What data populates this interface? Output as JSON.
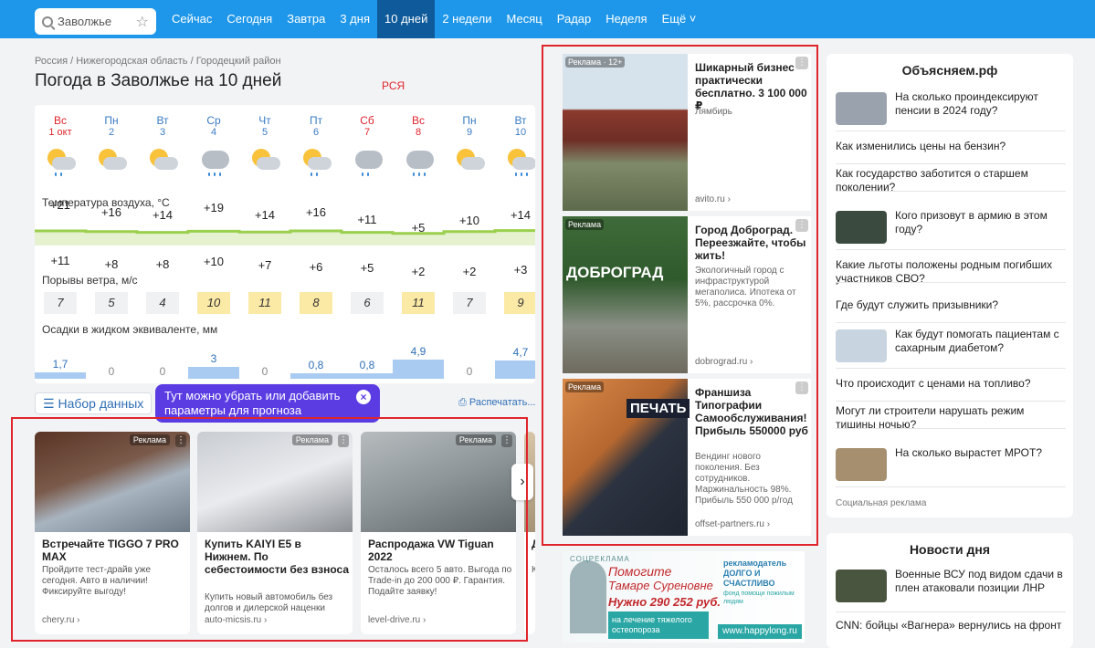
{
  "nav": {
    "search_text": "Заволжье",
    "items": [
      "Сейчас",
      "Сегодня",
      "Завтра",
      "3 дня",
      "10 дней",
      "2 недели",
      "Месяц",
      "Радар",
      "Неделя",
      "Ещё"
    ],
    "active_index": 4
  },
  "breadcrumbs": "Россия / Нижегородская область / Городецкий район",
  "title": "Погода в Заволжье на 10 дней",
  "annotation_rsya": "РСЯ",
  "forecast": {
    "days": [
      {
        "wd": "Вс",
        "date": "1 окт",
        "weekend": true,
        "icon": "partly-cloudy-light-rain-icon",
        "tmax": "+21",
        "tmin": "+11",
        "wind": "7",
        "precip": "1,7",
        "precip_value": 1.7
      },
      {
        "wd": "Пн",
        "date": "2",
        "weekend": false,
        "icon": "partly-cloudy-icon",
        "tmax": "+16",
        "tmin": "+8",
        "wind": "5",
        "precip": "0",
        "precip_value": 0
      },
      {
        "wd": "Вт",
        "date": "3",
        "weekend": false,
        "icon": "partly-cloudy-icon",
        "tmax": "+14",
        "tmin": "+8",
        "wind": "4",
        "precip": "0",
        "precip_value": 0
      },
      {
        "wd": "Ср",
        "date": "4",
        "weekend": false,
        "icon": "cloudy-rain-icon",
        "tmax": "+19",
        "tmin": "+10",
        "wind": "10",
        "precip": "3",
        "precip_value": 3
      },
      {
        "wd": "Чт",
        "date": "5",
        "weekend": false,
        "icon": "partly-cloudy-icon",
        "tmax": "+14",
        "tmin": "+7",
        "wind": "11",
        "precip": "0",
        "precip_value": 0
      },
      {
        "wd": "Пт",
        "date": "6",
        "weekend": false,
        "icon": "partly-cloudy-light-rain-icon",
        "tmax": "+16",
        "tmin": "+6",
        "wind": "8",
        "precip": "0,8",
        "precip_value": 0.8
      },
      {
        "wd": "Сб",
        "date": "7",
        "weekend": true,
        "icon": "cloudy-light-rain-icon",
        "tmax": "+11",
        "tmin": "+5",
        "wind": "6",
        "precip": "0,8",
        "precip_value": 0.8
      },
      {
        "wd": "Вс",
        "date": "8",
        "weekend": true,
        "icon": "cloudy-rain-icon",
        "tmax": "+5",
        "tmin": "+2",
        "wind": "11",
        "precip": "4,9",
        "precip_value": 4.9
      },
      {
        "wd": "Пн",
        "date": "9",
        "weekend": false,
        "icon": "partly-cloudy-icon",
        "tmax": "+10",
        "tmin": "+2",
        "wind": "7",
        "precip": "0",
        "precip_value": 0
      },
      {
        "wd": "Вт",
        "date": "10",
        "weekend": false,
        "icon": "partly-cloudy-rain-icon",
        "tmax": "+14",
        "tmin": "+3",
        "wind": "9",
        "precip": "4,7",
        "precip_value": 4.7
      }
    ],
    "temp_label": "Температура воздуха, °С",
    "wind_label": "Порывы ветра, м/с",
    "precip_label": "Осадки в жидком эквиваленте, мм"
  },
  "dataset_button": "Набор данных",
  "tooltip": "Тут можно убрать или добавить параметры для прогноза",
  "print_link": "Распечатать...",
  "bottom_ads": [
    {
      "tag": "Реклама",
      "title": "Встречайте TIGGO 7 PRO MAX",
      "desc": "Пройдите тест-драйв уже сегодня. Авто в наличии! Фиксируйте выгоду!",
      "src": "chery.ru"
    },
    {
      "tag": "Реклама",
      "title": "Купить KAIYI E5 в Нижнем. По себестоимости без взноса",
      "desc": "Купить новый автомобиль без долгов и дилерской наценки",
      "src": "auto-micsis.ru"
    },
    {
      "tag": "Реклама",
      "title": "Распродажа VW Tiguan 2022",
      "desc": "Осталось всего 5 авто. Выгода по Trade-in до 200 000 ₽. Гарантия. Подайте заявку!",
      "src": "level-drive.ru"
    },
    {
      "title": "До и б за l",
      "desc": "Кот «Жу дом сур",
      "src": ""
    }
  ],
  "side_ads": [
    {
      "tag": "Реклама · 12+",
      "title": "Шикарный бизнес практически бесплатно. 3 100 000 ₽",
      "desc": "Лямбирь",
      "src": "avito.ru"
    },
    {
      "tag": "Реклама",
      "title": "Город Доброград. Переезжайте, чтобы жить!",
      "desc": "Экологичный город с инфраструктурой мегаполиса. Ипотека от 5%, рассрочка 0%.",
      "src": "dobrograd.ru",
      "img_text": "ДОБРОГРАД"
    },
    {
      "tag": "Реклама",
      "title": "Франшиза Типографии Самообслуживания! Прибыль 550000 руб",
      "desc": "Вендинг нового поколения. Без сотрудников. Маржинальность 98%. Прибыль 550 000 р/год",
      "src": "offset-partners.ru",
      "img_text": "ПЕЧАТЬ"
    }
  ],
  "banner": {
    "label": "СОЦРЕКЛАМА",
    "line1": "Помогите",
    "line2": "Тамаре Суреновне",
    "line3": "Нужно 290 252 руб.",
    "line4": "на лечение тяжелого остеопороза",
    "org": "рекламодатель ДОЛГО И СЧАСТЛИВО",
    "org_sub": "фонд помощи пожилым людям",
    "url": "www.happylong.ru"
  },
  "explain": {
    "title": "Объясняем.рф",
    "items": [
      {
        "text": "На сколько проиндексируют пенсии в 2024 году?",
        "thumb": true
      },
      {
        "text": "Как изменились цены на бензин?",
        "thumb": false
      },
      {
        "text": "Как государство заботится о старшем поколении?",
        "thumb": false
      },
      {
        "text": "Кого призовут в армию в этом году?",
        "thumb": true
      },
      {
        "text": "Какие льготы положены родным погибших участников СВО?",
        "thumb": false
      },
      {
        "text": "Где будут служить призывники?",
        "thumb": false
      },
      {
        "text": "Как будут помогать пациентам с сахарным диабетом?",
        "thumb": true
      },
      {
        "text": "Что происходит с ценами на топливо?",
        "thumb": false
      },
      {
        "text": "Могут ли строители нарушать режим тишины ночью?",
        "thumb": false
      },
      {
        "text": "На сколько вырастет МРОТ?",
        "thumb": true
      }
    ],
    "footer": "Социальная реклама"
  },
  "news": {
    "title": "Новости дня",
    "items": [
      {
        "text": "Военные ВСУ под видом сдачи в плен атаковали позиции ЛНР",
        "thumb": true
      },
      {
        "text": "CNN: бойцы «Вагнера» вернулись на фронт",
        "thumb": false
      }
    ]
  }
}
